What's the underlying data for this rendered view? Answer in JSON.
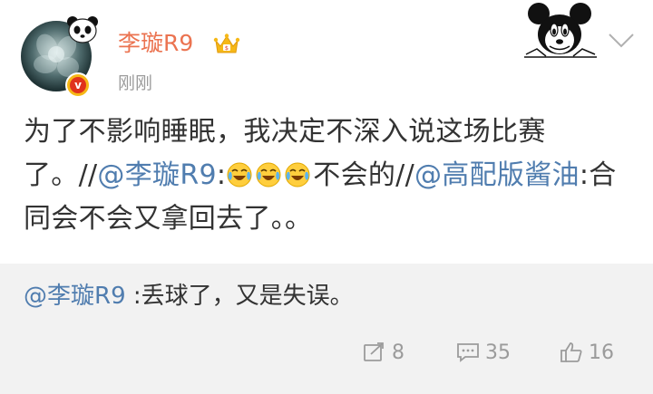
{
  "post": {
    "username": "李璇R9",
    "timestamp": "刚刚",
    "content": {
      "text1": "为了不影响睡眠，我决定不深入说这场比赛了。//",
      "mention1": "@李璇R9",
      "text2": ":",
      "emoji_count": 3,
      "text3": "不会的//",
      "mention2": "@高配版酱油",
      "text4": ":合同会不会又拿回去了。。"
    }
  },
  "retweet": {
    "mention": "@李璇R9",
    "text": " :丢球了，又是失误。"
  },
  "actions": {
    "repost_count": "8",
    "comment_count": "35",
    "like_count": "16"
  },
  "colors": {
    "username": "#eb7350",
    "mention": "#507daf",
    "meta": "#9b9b9b",
    "retweet_bg": "#f2f2f2"
  },
  "icons": [
    "panda-icon",
    "verified-badge-icon",
    "crown-icon",
    "mickey-mouse-icon",
    "chevron-down-icon",
    "laugh-cry-emoji-icon",
    "repost-icon",
    "comment-icon",
    "like-icon"
  ]
}
